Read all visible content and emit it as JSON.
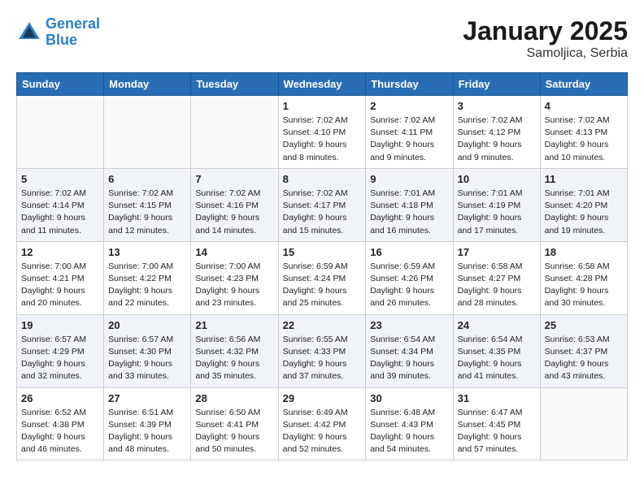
{
  "header": {
    "logo_line1": "General",
    "logo_line2": "Blue",
    "title": "January 2025",
    "subtitle": "Samoljica, Serbia"
  },
  "weekdays": [
    "Sunday",
    "Monday",
    "Tuesday",
    "Wednesday",
    "Thursday",
    "Friday",
    "Saturday"
  ],
  "weeks": [
    [
      {
        "day": "",
        "info": ""
      },
      {
        "day": "",
        "info": ""
      },
      {
        "day": "",
        "info": ""
      },
      {
        "day": "1",
        "info": "Sunrise: 7:02 AM\nSunset: 4:10 PM\nDaylight: 9 hours\nand 8 minutes."
      },
      {
        "day": "2",
        "info": "Sunrise: 7:02 AM\nSunset: 4:11 PM\nDaylight: 9 hours\nand 9 minutes."
      },
      {
        "day": "3",
        "info": "Sunrise: 7:02 AM\nSunset: 4:12 PM\nDaylight: 9 hours\nand 9 minutes."
      },
      {
        "day": "4",
        "info": "Sunrise: 7:02 AM\nSunset: 4:13 PM\nDaylight: 9 hours\nand 10 minutes."
      }
    ],
    [
      {
        "day": "5",
        "info": "Sunrise: 7:02 AM\nSunset: 4:14 PM\nDaylight: 9 hours\nand 11 minutes."
      },
      {
        "day": "6",
        "info": "Sunrise: 7:02 AM\nSunset: 4:15 PM\nDaylight: 9 hours\nand 12 minutes."
      },
      {
        "day": "7",
        "info": "Sunrise: 7:02 AM\nSunset: 4:16 PM\nDaylight: 9 hours\nand 14 minutes."
      },
      {
        "day": "8",
        "info": "Sunrise: 7:02 AM\nSunset: 4:17 PM\nDaylight: 9 hours\nand 15 minutes."
      },
      {
        "day": "9",
        "info": "Sunrise: 7:01 AM\nSunset: 4:18 PM\nDaylight: 9 hours\nand 16 minutes."
      },
      {
        "day": "10",
        "info": "Sunrise: 7:01 AM\nSunset: 4:19 PM\nDaylight: 9 hours\nand 17 minutes."
      },
      {
        "day": "11",
        "info": "Sunrise: 7:01 AM\nSunset: 4:20 PM\nDaylight: 9 hours\nand 19 minutes."
      }
    ],
    [
      {
        "day": "12",
        "info": "Sunrise: 7:00 AM\nSunset: 4:21 PM\nDaylight: 9 hours\nand 20 minutes."
      },
      {
        "day": "13",
        "info": "Sunrise: 7:00 AM\nSunset: 4:22 PM\nDaylight: 9 hours\nand 22 minutes."
      },
      {
        "day": "14",
        "info": "Sunrise: 7:00 AM\nSunset: 4:23 PM\nDaylight: 9 hours\nand 23 minutes."
      },
      {
        "day": "15",
        "info": "Sunrise: 6:59 AM\nSunset: 4:24 PM\nDaylight: 9 hours\nand 25 minutes."
      },
      {
        "day": "16",
        "info": "Sunrise: 6:59 AM\nSunset: 4:26 PM\nDaylight: 9 hours\nand 26 minutes."
      },
      {
        "day": "17",
        "info": "Sunrise: 6:58 AM\nSunset: 4:27 PM\nDaylight: 9 hours\nand 28 minutes."
      },
      {
        "day": "18",
        "info": "Sunrise: 6:58 AM\nSunset: 4:28 PM\nDaylight: 9 hours\nand 30 minutes."
      }
    ],
    [
      {
        "day": "19",
        "info": "Sunrise: 6:57 AM\nSunset: 4:29 PM\nDaylight: 9 hours\nand 32 minutes."
      },
      {
        "day": "20",
        "info": "Sunrise: 6:57 AM\nSunset: 4:30 PM\nDaylight: 9 hours\nand 33 minutes."
      },
      {
        "day": "21",
        "info": "Sunrise: 6:56 AM\nSunset: 4:32 PM\nDaylight: 9 hours\nand 35 minutes."
      },
      {
        "day": "22",
        "info": "Sunrise: 6:55 AM\nSunset: 4:33 PM\nDaylight: 9 hours\nand 37 minutes."
      },
      {
        "day": "23",
        "info": "Sunrise: 6:54 AM\nSunset: 4:34 PM\nDaylight: 9 hours\nand 39 minutes."
      },
      {
        "day": "24",
        "info": "Sunrise: 6:54 AM\nSunset: 4:35 PM\nDaylight: 9 hours\nand 41 minutes."
      },
      {
        "day": "25",
        "info": "Sunrise: 6:53 AM\nSunset: 4:37 PM\nDaylight: 9 hours\nand 43 minutes."
      }
    ],
    [
      {
        "day": "26",
        "info": "Sunrise: 6:52 AM\nSunset: 4:38 PM\nDaylight: 9 hours\nand 46 minutes."
      },
      {
        "day": "27",
        "info": "Sunrise: 6:51 AM\nSunset: 4:39 PM\nDaylight: 9 hours\nand 48 minutes."
      },
      {
        "day": "28",
        "info": "Sunrise: 6:50 AM\nSunset: 4:41 PM\nDaylight: 9 hours\nand 50 minutes."
      },
      {
        "day": "29",
        "info": "Sunrise: 6:49 AM\nSunset: 4:42 PM\nDaylight: 9 hours\nand 52 minutes."
      },
      {
        "day": "30",
        "info": "Sunrise: 6:48 AM\nSunset: 4:43 PM\nDaylight: 9 hours\nand 54 minutes."
      },
      {
        "day": "31",
        "info": "Sunrise: 6:47 AM\nSunset: 4:45 PM\nDaylight: 9 hours\nand 57 minutes."
      },
      {
        "day": "",
        "info": ""
      }
    ]
  ]
}
